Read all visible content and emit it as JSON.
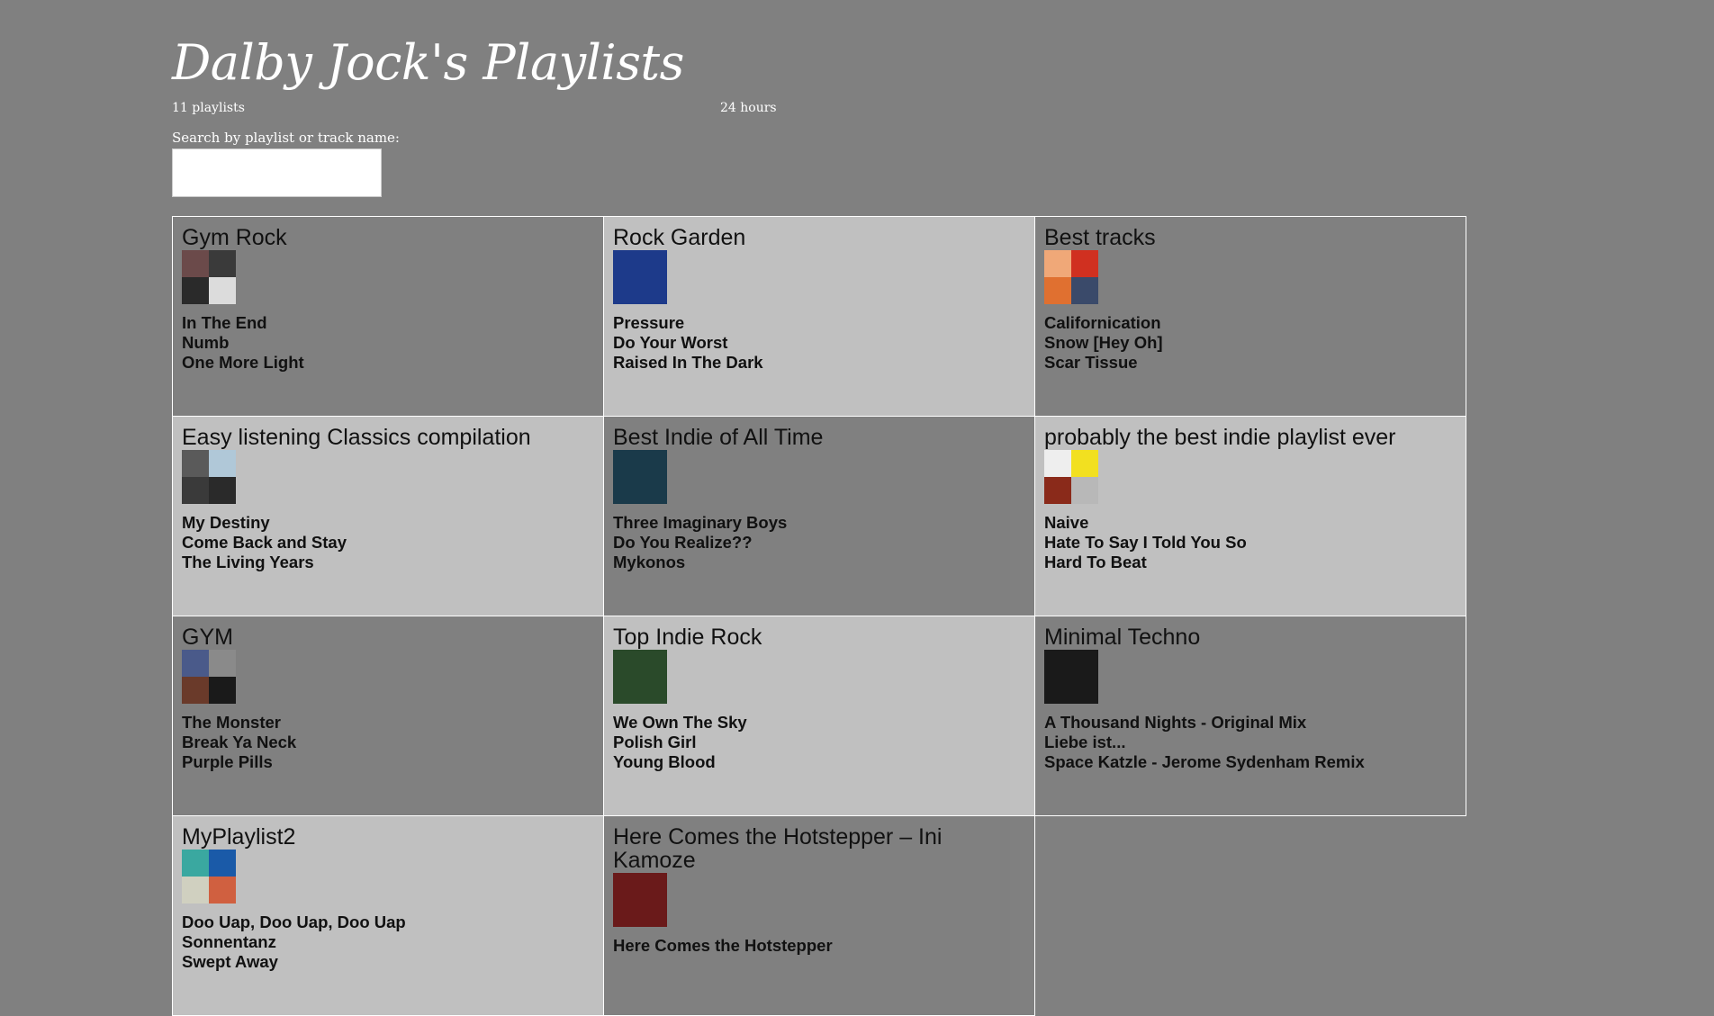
{
  "header": {
    "title": "Dalby Jock's Playlists",
    "playlist_count": "11 playlists",
    "hours": "24 hours"
  },
  "search": {
    "label": "Search by playlist or track name:",
    "value": "",
    "placeholder": ""
  },
  "playlists": [
    {
      "name": "Gym Rock",
      "cover_type": "quad",
      "cover_colors": [
        "#6b4a4a",
        "#3a3a3a",
        "#2a2a2a",
        "#dcdcdc"
      ],
      "tracks": [
        "In The End",
        "Numb",
        "One More Light"
      ]
    },
    {
      "name": "Rock Garden",
      "cover_type": "single",
      "cover_colors": [
        "#1d3a8a"
      ],
      "tracks": [
        "Pressure",
        "Do Your Worst",
        "Raised In The Dark"
      ]
    },
    {
      "name": "Best tracks",
      "cover_type": "quad",
      "cover_colors": [
        "#f0a878",
        "#d03020",
        "#e07030",
        "#3a4a6a"
      ],
      "tracks": [
        "Californication",
        "Snow [Hey Oh]",
        "Scar Tissue"
      ]
    },
    {
      "name": "Easy listening Classics compilation",
      "cover_type": "quad",
      "cover_colors": [
        "#5a5a5a",
        "#b0c8d8",
        "#3a3a3a",
        "#2a2a2a"
      ],
      "tracks": [
        "My Destiny",
        "Come Back and Stay",
        "The Living Years"
      ]
    },
    {
      "name": "Best Indie of All Time",
      "cover_type": "single",
      "cover_colors": [
        "#1a3a4a"
      ],
      "tracks": [
        "Three Imaginary Boys",
        "Do You Realize??",
        "Mykonos"
      ]
    },
    {
      "name": "probably the best indie playlist ever",
      "cover_type": "quad",
      "cover_colors": [
        "#eeeeee",
        "#f2e020",
        "#8a2a1a",
        "#b8b8b8"
      ],
      "tracks": [
        "Naive",
        "Hate To Say I Told You So",
        "Hard To Beat"
      ]
    },
    {
      "name": "GYM",
      "cover_type": "quad",
      "cover_colors": [
        "#4a5a8a",
        "#8a8a8a",
        "#6a3a2a",
        "#1a1a1a"
      ],
      "tracks": [
        "The Monster",
        "Break Ya Neck",
        "Purple Pills"
      ]
    },
    {
      "name": "Top Indie Rock",
      "cover_type": "single",
      "cover_colors": [
        "#2a4a2a"
      ],
      "tracks": [
        "We Own The Sky",
        "Polish Girl",
        "Young Blood"
      ]
    },
    {
      "name": "Minimal Techno",
      "cover_type": "single",
      "cover_colors": [
        "#1a1a1a"
      ],
      "tracks": [
        "A Thousand Nights - Original Mix",
        "Liebe ist...",
        "Space Katzle - Jerome Sydenham Remix"
      ]
    },
    {
      "name": "MyPlaylist2",
      "cover_type": "quad",
      "cover_colors": [
        "#3aa8a0",
        "#1a5aa8",
        "#d0d0c0",
        "#d06040"
      ],
      "tracks": [
        "Doo Uap, Doo Uap, Doo Uap",
        "Sonnentanz",
        "Swept Away"
      ]
    },
    {
      "name": "Here Comes the Hotstepper – Ini Kamoze",
      "cover_type": "single",
      "cover_colors": [
        "#6a1a1a"
      ],
      "tracks": [
        "Here Comes the Hotstepper"
      ]
    }
  ]
}
